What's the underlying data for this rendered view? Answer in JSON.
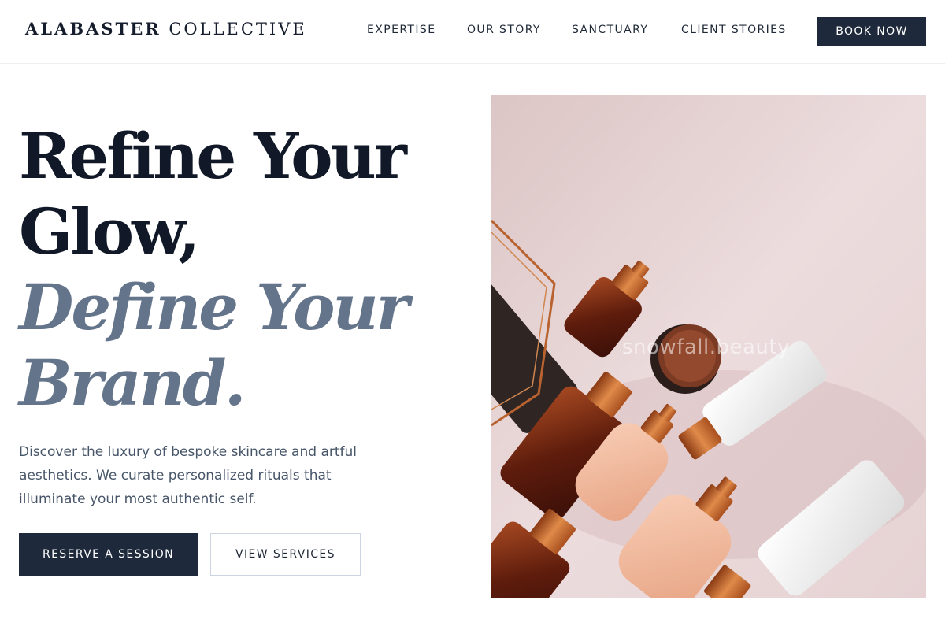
{
  "brand": {
    "name_strong": "ALABASTER",
    "name_light": "COLLECTIVE"
  },
  "nav": {
    "items": [
      {
        "label": "EXPERTISE"
      },
      {
        "label": "OUR STORY"
      },
      {
        "label": "SANCTUARY"
      },
      {
        "label": "CLIENT STORIES"
      }
    ],
    "cta_label": "BOOK NOW"
  },
  "hero": {
    "headline_line1": "Refine Your",
    "headline_line2": "Glow,",
    "headline_line3": "Define Your",
    "headline_line4": "Brand.",
    "description": "Discover the luxury of bespoke skincare and artful aesthetics. We curate personalized rituals that illuminate your most authentic self.",
    "primary_cta": "RESERVE A SESSION",
    "secondary_cta": "VIEW SERVICES",
    "image_watermark": "snowfall.beauty"
  },
  "colors": {
    "navy": "#1e293b",
    "slate_accent": "#64748b",
    "image_background": "#e8d8d9",
    "copper": "#c0632a"
  }
}
